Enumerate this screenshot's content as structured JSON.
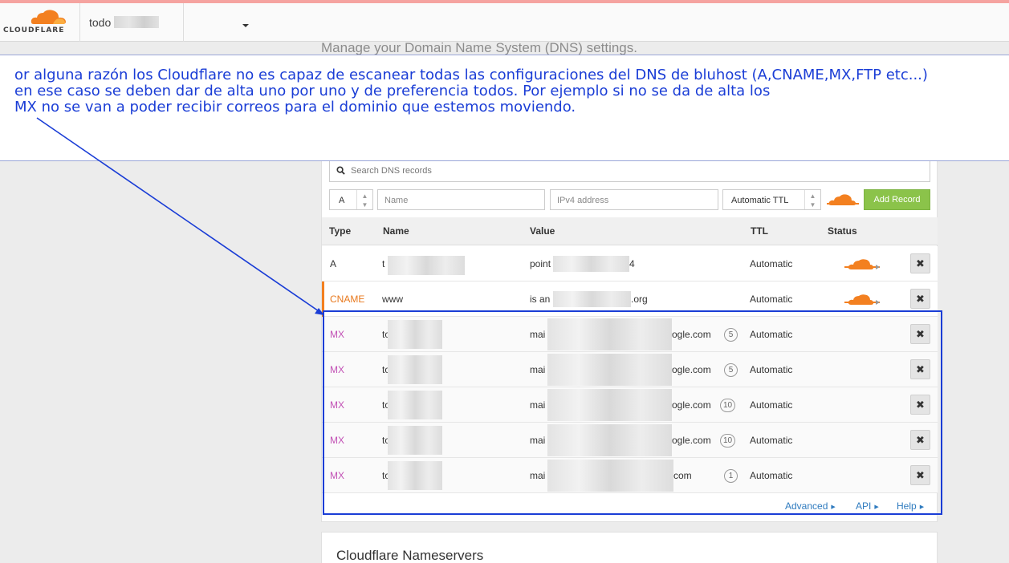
{
  "brand": {
    "logo_text": "CLOUDFLARE",
    "orange": "#F38020"
  },
  "header": {
    "domain_name": "todo",
    "subtitle": "Manage your Domain Name System (DNS) settings."
  },
  "annotation": {
    "lines": [
      "or alguna razón los Cloudflare no es capaz de escanear todas las configuraciones del DNS de bluhost (A,CNAME,MX,FTP etc...)",
      "en ese caso se deben dar de alta uno por uno y de preferencia todos. Por ejemplo si no se da de alta los",
      "MX no se van a poder recibir correos para el dominio que estemos moviendo."
    ],
    "color": "#1A3DD6"
  },
  "dns": {
    "search_placeholder": "Search DNS records",
    "form": {
      "type": "A",
      "name_placeholder": "Name",
      "value_placeholder": "IPv4 address",
      "ttl": "Automatic TTL",
      "add_label": "Add Record"
    },
    "columns": {
      "type": "Type",
      "name": "Name",
      "value": "Value",
      "ttl": "TTL",
      "status": "Status"
    },
    "records": [
      {
        "type": "A",
        "name": "t",
        "value_start": "point",
        "value_end": "4",
        "priority": "",
        "ttl": "Automatic",
        "proxied": true
      },
      {
        "type": "CNAME",
        "name": "www",
        "value_start": "is an",
        "value_end": ".org",
        "priority": "",
        "ttl": "Automatic",
        "proxied": true
      },
      {
        "type": "MX",
        "name": "to",
        "value_start": "mai",
        "value_end": "ogle.com",
        "priority": "5",
        "ttl": "Automatic",
        "proxied": false
      },
      {
        "type": "MX",
        "name": "to",
        "value_start": "mai",
        "value_end": "ogle.com",
        "priority": "5",
        "ttl": "Automatic",
        "proxied": false
      },
      {
        "type": "MX",
        "name": "to",
        "value_start": "mai",
        "value_end": "ogle.com",
        "priority": "10",
        "ttl": "Automatic",
        "proxied": false
      },
      {
        "type": "MX",
        "name": "to",
        "value_start": "mai",
        "value_end": "ogle.com",
        "priority": "10",
        "ttl": "Automatic",
        "proxied": false
      },
      {
        "type": "MX",
        "name": "to",
        "value_start": "mai",
        "value_end": "com",
        "priority": "1",
        "ttl": "Automatic",
        "proxied": false
      }
    ],
    "delete_symbol": "✖",
    "footer_links": {
      "advanced": "Advanced",
      "api": "API",
      "help": "Help"
    }
  },
  "nameservers": {
    "title": "Cloudflare Nameservers"
  }
}
